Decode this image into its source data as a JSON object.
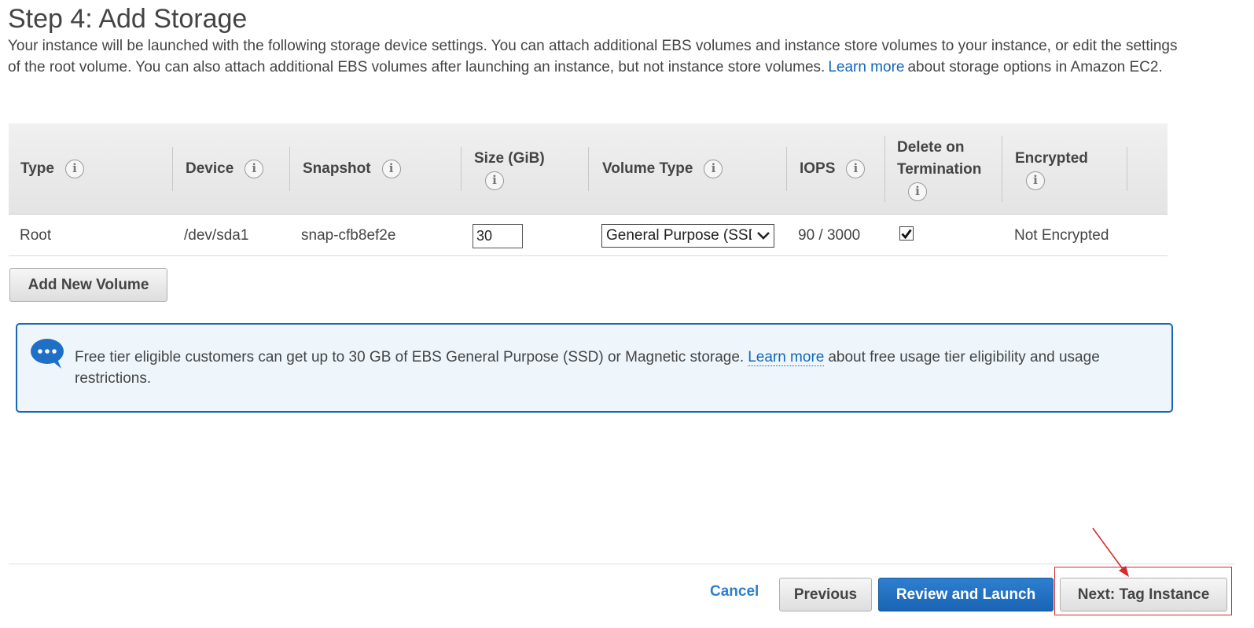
{
  "page": {
    "title": "Step 4: Add Storage",
    "intro_before_link": "Your instance will be launched with the following storage device settings. You can attach additional EBS volumes and instance store volumes to your instance, or edit the settings of the root volume. You can also attach additional EBS volumes after launching an instance, but not instance store volumes.",
    "intro_link": "Learn more",
    "intro_after_link": "about storage options in Amazon EC2."
  },
  "table": {
    "headers": {
      "type": "Type",
      "device": "Device",
      "snapshot": "Snapshot",
      "size": "Size (GiB)",
      "volume_type": "Volume Type",
      "iops": "IOPS",
      "delete_line1": "Delete on",
      "delete_line2": "Termination",
      "encrypted": "Encrypted"
    },
    "row": {
      "type": "Root",
      "device": "/dev/sda1",
      "snapshot": "snap-cfb8ef2e",
      "size": "30",
      "volume_type": "General Purpose (SSD)",
      "iops": "90 / 3000",
      "delete_on_termination": true,
      "encrypted": "Not Encrypted"
    },
    "info_glyph": "i"
  },
  "add_volume_label": "Add New Volume",
  "notice": {
    "icon": "speech-bubble-icon",
    "text_before_link": "Free tier eligible customers can get up to 30 GB of EBS General Purpose (SSD) or Magnetic storage.",
    "link": "Learn more",
    "text_after_link": "about free usage tier eligibility and usage restrictions."
  },
  "footer": {
    "cancel": "Cancel",
    "previous": "Previous",
    "review_launch": "Review and Launch",
    "next": "Next: Tag Instance"
  },
  "colors": {
    "link": "#1166bb",
    "primary_button": "#1a64b4",
    "notice_border": "#1a66b0",
    "notice_bg": "#eef6fc",
    "annotation": "#d42a2a"
  }
}
